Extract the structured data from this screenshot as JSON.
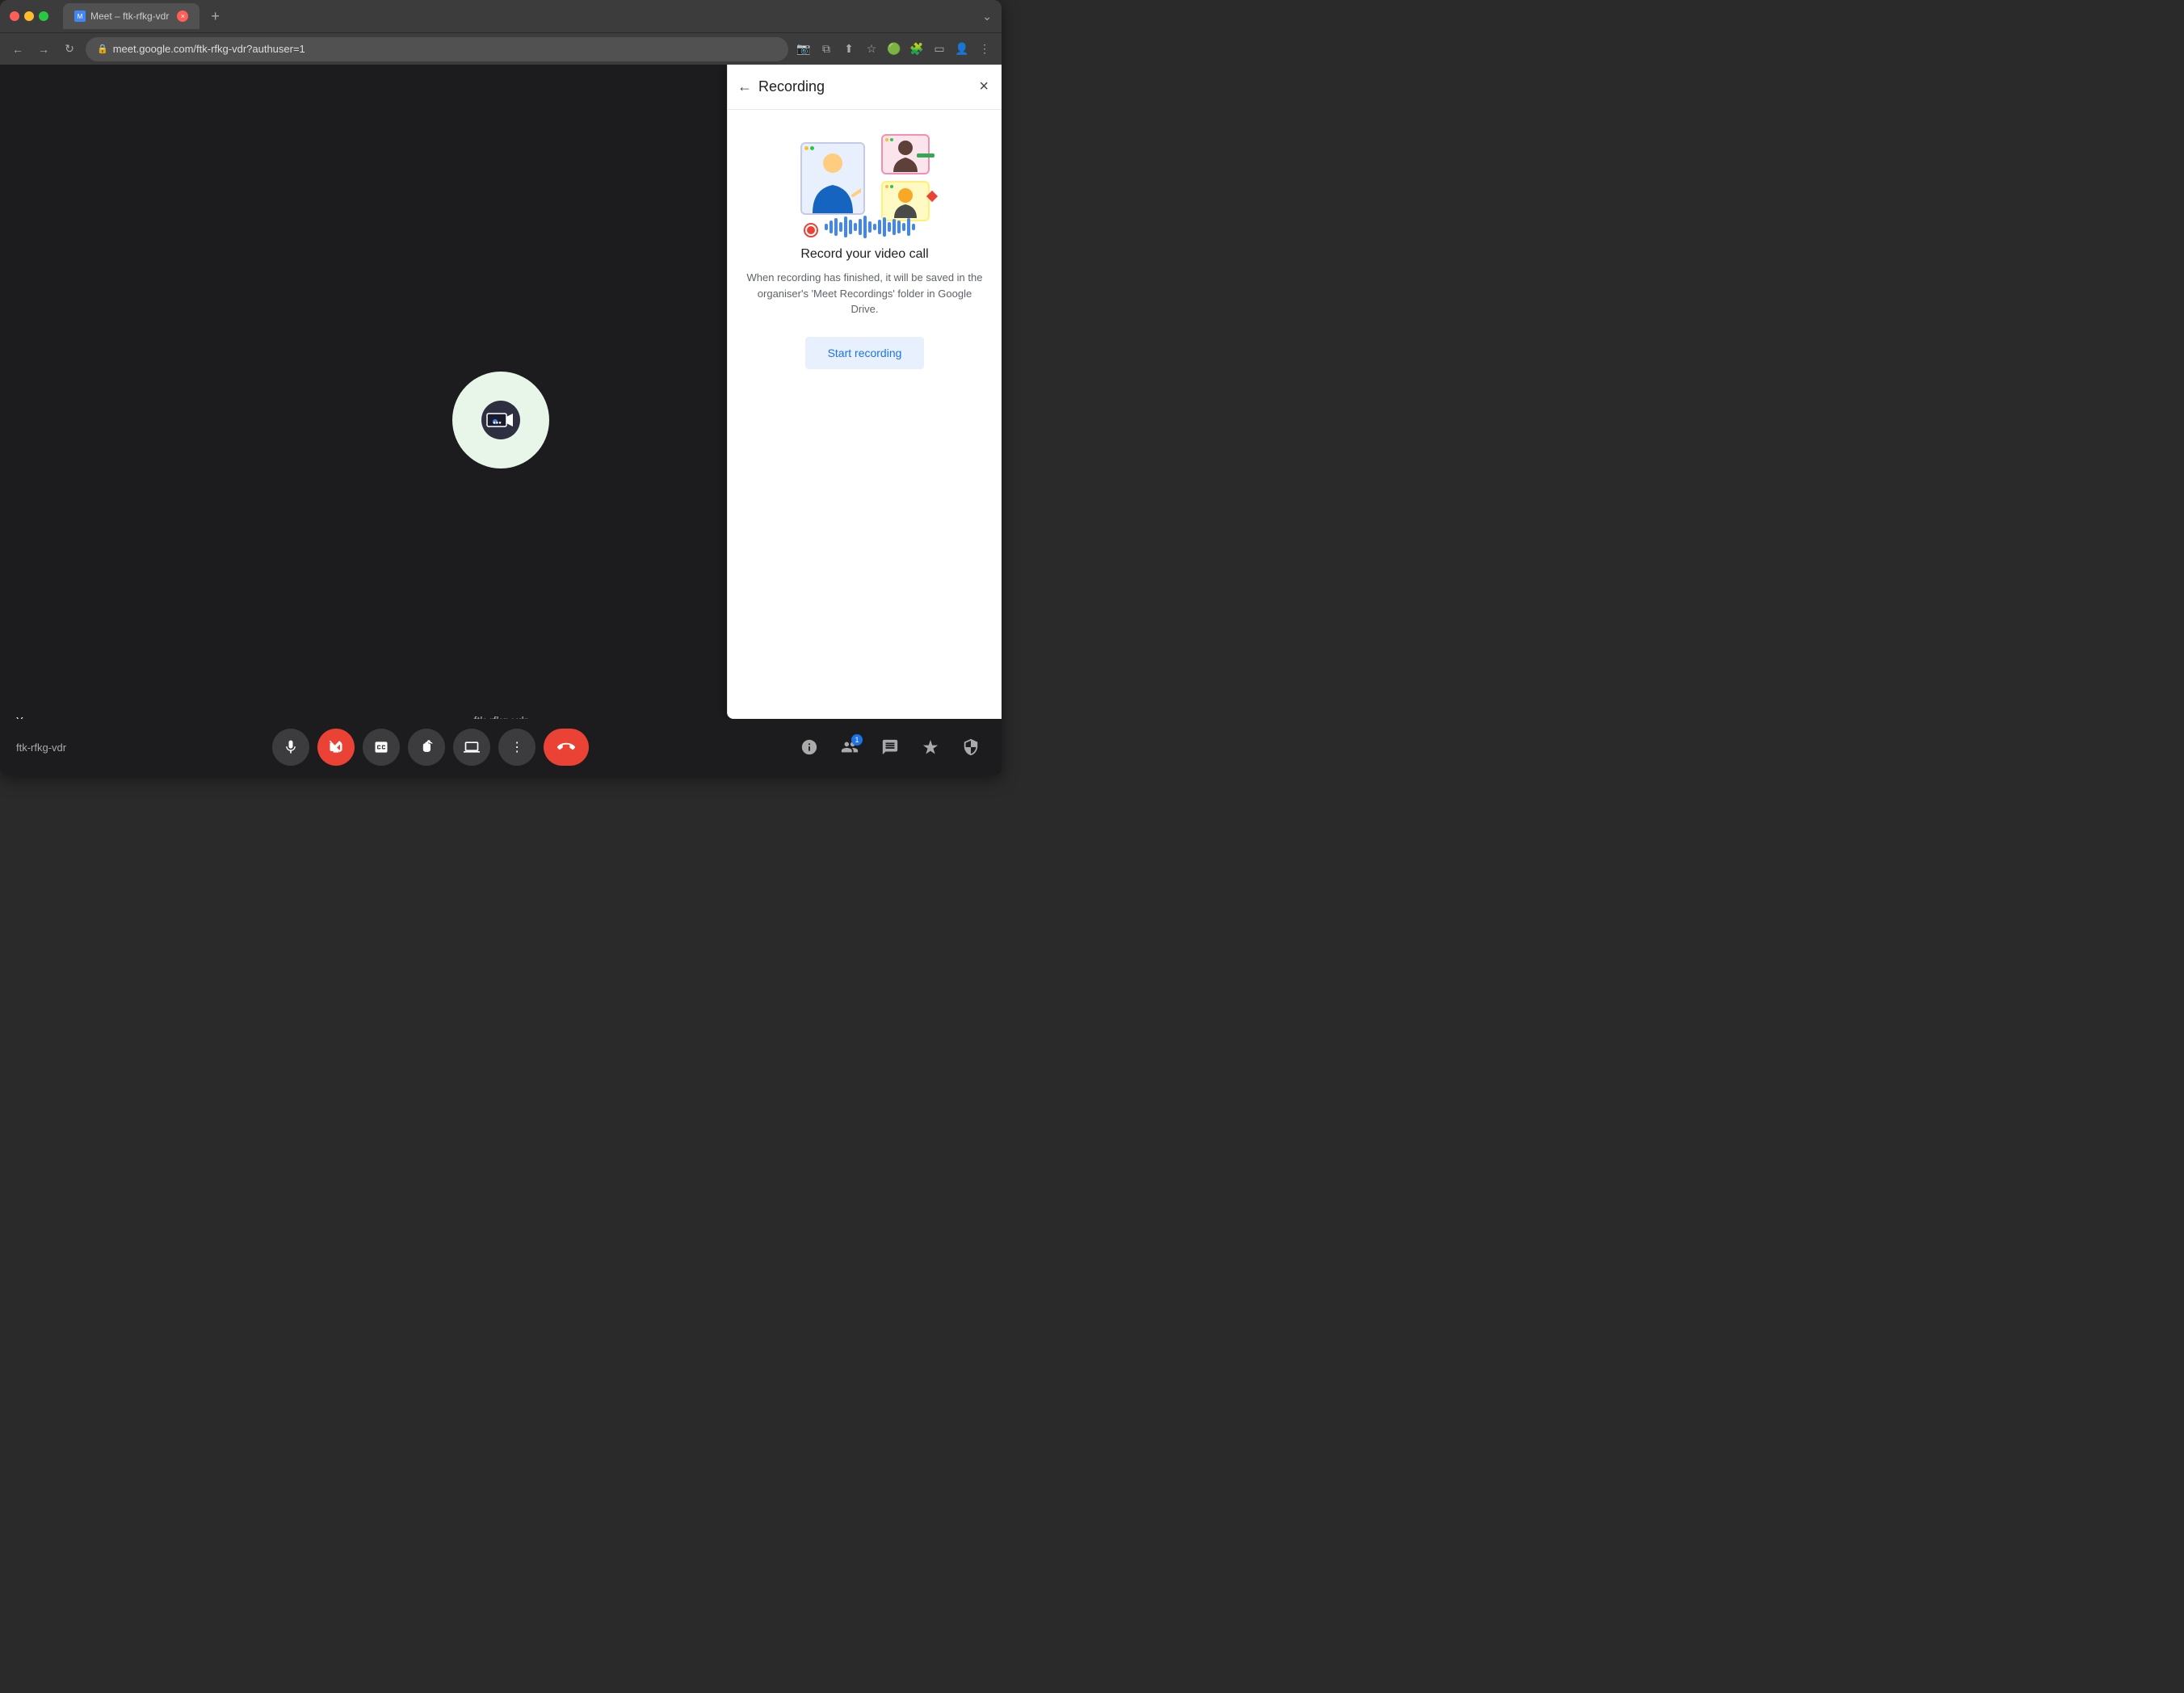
{
  "browser": {
    "tab_title": "Meet – ftk-rfkg-vdr",
    "url": "meet.google.com/ftk-rfkg-vdr?authuser=1",
    "tab_close_label": "×",
    "new_tab_label": "+",
    "collapse_label": "⌄"
  },
  "nav": {
    "back": "←",
    "forward": "→",
    "refresh": "↻",
    "lock_icon": "🔒"
  },
  "video": {
    "participant_label": "You",
    "meeting_id": "ftk-rfkg-vdr"
  },
  "controls": {
    "mic_icon": "🎤",
    "camera_off_icon": "📵",
    "captions_icon": "CC",
    "hand_icon": "✋",
    "present_icon": "⬆",
    "more_icon": "⋮",
    "end_icon": "📞"
  },
  "right_controls": {
    "info_icon": "ℹ",
    "people_icon": "👥",
    "chat_icon": "💬",
    "activities_icon": "✦",
    "safety_icon": "🔒",
    "people_badge": "1"
  },
  "recording_panel": {
    "back_icon": "←",
    "title": "Recording",
    "close_icon": "×",
    "heading": "Record your video call",
    "description": "When recording has finished, it will be saved in the organiser's 'Meet Recordings' folder in Google Drive.",
    "start_button_label": "Start recording"
  },
  "more_options": {
    "icon": "⋯"
  }
}
